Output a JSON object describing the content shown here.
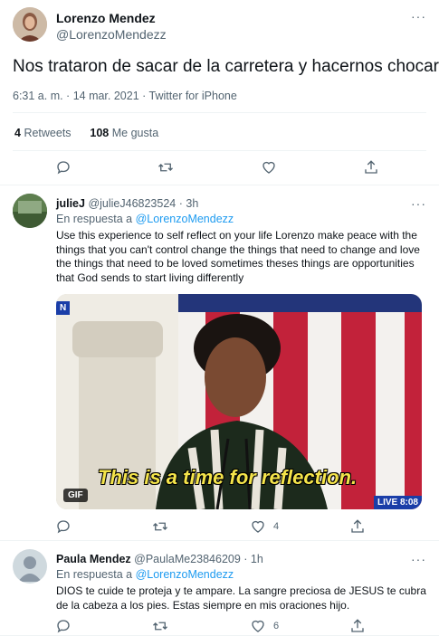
{
  "main_tweet": {
    "name": "Lorenzo Mendez",
    "handle": "@LorenzoMendezz",
    "text": "Nos trataron de sacar de la carretera y hacernos chocar",
    "meta": "6:31 a. m. · 14 mar. 2021 · Twitter for iPhone",
    "retweets_count": "4",
    "retweets_label": "Retweets",
    "likes_count": "108",
    "likes_label": "Me gusta",
    "more_label": "···"
  },
  "replies": [
    {
      "name": "julieJ",
      "handle": "@julieJ46823524",
      "time": "· 3h",
      "reply_to_prefix": "En respuesta a",
      "reply_to_handle": "@LorenzoMendezz",
      "text": "Use this experience to self reflect on your life Lorenzo make peace with the things that you can't control change the things that need to change and love the things that need to be loved sometimes theses things are opportunities that God sends to start living differently",
      "media": {
        "caption": "This is a time for reflection.",
        "gif_badge": "GIF",
        "live_badge": "LIVE 8:08",
        "logo": "N"
      },
      "likes": "4"
    },
    {
      "name": "Paula Mendez",
      "handle": "@PaulaMe23846209",
      "time": "· 1h",
      "reply_to_prefix": "En respuesta a",
      "reply_to_handle": "@LorenzoMendezz",
      "text": "DIOS te cuide te proteja y te ampare. La sangre preciosa de JESUS te cubra de la cabeza a los pies. Estas siempre en mis oraciones hijo.",
      "likes": "6"
    }
  ],
  "colors": {
    "text_primary": "#0f1419",
    "text_secondary": "#536471",
    "link": "#1d9bf0",
    "divider": "#eff3f4"
  },
  "icons": [
    "reply-icon",
    "retweet-icon",
    "like-icon",
    "share-icon",
    "more-icon"
  ]
}
